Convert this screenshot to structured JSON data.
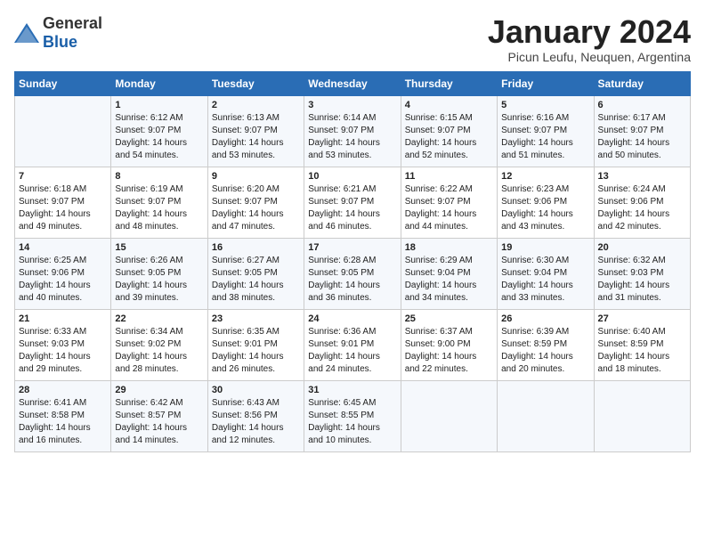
{
  "header": {
    "logo_general": "General",
    "logo_blue": "Blue",
    "month_title": "January 2024",
    "subtitle": "Picun Leufu, Neuquen, Argentina"
  },
  "days_of_week": [
    "Sunday",
    "Monday",
    "Tuesday",
    "Wednesday",
    "Thursday",
    "Friday",
    "Saturday"
  ],
  "weeks": [
    [
      {
        "day": "",
        "detail": ""
      },
      {
        "day": "1",
        "detail": "Sunrise: 6:12 AM\nSunset: 9:07 PM\nDaylight: 14 hours\nand 54 minutes."
      },
      {
        "day": "2",
        "detail": "Sunrise: 6:13 AM\nSunset: 9:07 PM\nDaylight: 14 hours\nand 53 minutes."
      },
      {
        "day": "3",
        "detail": "Sunrise: 6:14 AM\nSunset: 9:07 PM\nDaylight: 14 hours\nand 53 minutes."
      },
      {
        "day": "4",
        "detail": "Sunrise: 6:15 AM\nSunset: 9:07 PM\nDaylight: 14 hours\nand 52 minutes."
      },
      {
        "day": "5",
        "detail": "Sunrise: 6:16 AM\nSunset: 9:07 PM\nDaylight: 14 hours\nand 51 minutes."
      },
      {
        "day": "6",
        "detail": "Sunrise: 6:17 AM\nSunset: 9:07 PM\nDaylight: 14 hours\nand 50 minutes."
      }
    ],
    [
      {
        "day": "7",
        "detail": "Sunrise: 6:18 AM\nSunset: 9:07 PM\nDaylight: 14 hours\nand 49 minutes."
      },
      {
        "day": "8",
        "detail": "Sunrise: 6:19 AM\nSunset: 9:07 PM\nDaylight: 14 hours\nand 48 minutes."
      },
      {
        "day": "9",
        "detail": "Sunrise: 6:20 AM\nSunset: 9:07 PM\nDaylight: 14 hours\nand 47 minutes."
      },
      {
        "day": "10",
        "detail": "Sunrise: 6:21 AM\nSunset: 9:07 PM\nDaylight: 14 hours\nand 46 minutes."
      },
      {
        "day": "11",
        "detail": "Sunrise: 6:22 AM\nSunset: 9:07 PM\nDaylight: 14 hours\nand 44 minutes."
      },
      {
        "day": "12",
        "detail": "Sunrise: 6:23 AM\nSunset: 9:06 PM\nDaylight: 14 hours\nand 43 minutes."
      },
      {
        "day": "13",
        "detail": "Sunrise: 6:24 AM\nSunset: 9:06 PM\nDaylight: 14 hours\nand 42 minutes."
      }
    ],
    [
      {
        "day": "14",
        "detail": "Sunrise: 6:25 AM\nSunset: 9:06 PM\nDaylight: 14 hours\nand 40 minutes."
      },
      {
        "day": "15",
        "detail": "Sunrise: 6:26 AM\nSunset: 9:05 PM\nDaylight: 14 hours\nand 39 minutes."
      },
      {
        "day": "16",
        "detail": "Sunrise: 6:27 AM\nSunset: 9:05 PM\nDaylight: 14 hours\nand 38 minutes."
      },
      {
        "day": "17",
        "detail": "Sunrise: 6:28 AM\nSunset: 9:05 PM\nDaylight: 14 hours\nand 36 minutes."
      },
      {
        "day": "18",
        "detail": "Sunrise: 6:29 AM\nSunset: 9:04 PM\nDaylight: 14 hours\nand 34 minutes."
      },
      {
        "day": "19",
        "detail": "Sunrise: 6:30 AM\nSunset: 9:04 PM\nDaylight: 14 hours\nand 33 minutes."
      },
      {
        "day": "20",
        "detail": "Sunrise: 6:32 AM\nSunset: 9:03 PM\nDaylight: 14 hours\nand 31 minutes."
      }
    ],
    [
      {
        "day": "21",
        "detail": "Sunrise: 6:33 AM\nSunset: 9:03 PM\nDaylight: 14 hours\nand 29 minutes."
      },
      {
        "day": "22",
        "detail": "Sunrise: 6:34 AM\nSunset: 9:02 PM\nDaylight: 14 hours\nand 28 minutes."
      },
      {
        "day": "23",
        "detail": "Sunrise: 6:35 AM\nSunset: 9:01 PM\nDaylight: 14 hours\nand 26 minutes."
      },
      {
        "day": "24",
        "detail": "Sunrise: 6:36 AM\nSunset: 9:01 PM\nDaylight: 14 hours\nand 24 minutes."
      },
      {
        "day": "25",
        "detail": "Sunrise: 6:37 AM\nSunset: 9:00 PM\nDaylight: 14 hours\nand 22 minutes."
      },
      {
        "day": "26",
        "detail": "Sunrise: 6:39 AM\nSunset: 8:59 PM\nDaylight: 14 hours\nand 20 minutes."
      },
      {
        "day": "27",
        "detail": "Sunrise: 6:40 AM\nSunset: 8:59 PM\nDaylight: 14 hours\nand 18 minutes."
      }
    ],
    [
      {
        "day": "28",
        "detail": "Sunrise: 6:41 AM\nSunset: 8:58 PM\nDaylight: 14 hours\nand 16 minutes."
      },
      {
        "day": "29",
        "detail": "Sunrise: 6:42 AM\nSunset: 8:57 PM\nDaylight: 14 hours\nand 14 minutes."
      },
      {
        "day": "30",
        "detail": "Sunrise: 6:43 AM\nSunset: 8:56 PM\nDaylight: 14 hours\nand 12 minutes."
      },
      {
        "day": "31",
        "detail": "Sunrise: 6:45 AM\nSunset: 8:55 PM\nDaylight: 14 hours\nand 10 minutes."
      },
      {
        "day": "",
        "detail": ""
      },
      {
        "day": "",
        "detail": ""
      },
      {
        "day": "",
        "detail": ""
      }
    ]
  ]
}
